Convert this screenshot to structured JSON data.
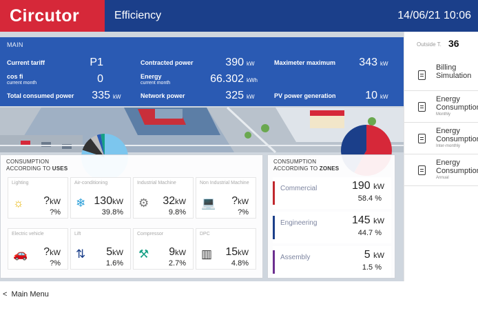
{
  "header": {
    "logo": "Circutor",
    "title": "Efficiency",
    "datetime": "14/06/21 10:06"
  },
  "main": {
    "section": "MAIN",
    "rows": [
      [
        {
          "label": "Current tariff",
          "value": "P1",
          "unit": ""
        },
        {
          "label": "Contracted power",
          "value": "390",
          "unit": "kW"
        },
        {
          "label": "Maximeter maximum",
          "value": "343",
          "unit": "kW"
        }
      ],
      [
        {
          "label": "cos fi",
          "sublabel": "current month",
          "value": "0",
          "unit": ""
        },
        {
          "label": "Energy",
          "sublabel": "current month",
          "value": "66.302",
          "unit": "kWh"
        }
      ],
      [
        {
          "label": "Total consumed power",
          "value": "335",
          "unit": "kW"
        },
        {
          "label": "Network power",
          "value": "325",
          "unit": "kW"
        },
        {
          "label": "PV power generation",
          "value": "10",
          "unit": "kW"
        }
      ]
    ]
  },
  "uses": {
    "title_line1": "CONSUMPTION",
    "title_line2_prefix": "ACCORDING TO ",
    "title_line2_bold": "USES",
    "tiles": [
      {
        "name": "Lighting",
        "icon": "sun-icon",
        "glyph": "☼",
        "color": "#e8b400",
        "kw": "?",
        "kw_unit": "kW",
        "pct": "?",
        "pct_unit": "%"
      },
      {
        "name": "Air-conditioning",
        "icon": "snowflake-icon",
        "glyph": "❄",
        "color": "#2b9fd8",
        "kw": "130",
        "kw_unit": "kW",
        "pct": "39.8",
        "pct_unit": "%"
      },
      {
        "name": "Industrial Machine",
        "icon": "gear-icon",
        "glyph": "⚙",
        "color": "#777777",
        "kw": "32",
        "kw_unit": "kW",
        "pct": "9.8",
        "pct_unit": "%"
      },
      {
        "name": "Non Industrial Machine",
        "icon": "laptop-icon",
        "glyph": "💻",
        "color": "#d62839",
        "kw": "?",
        "kw_unit": "kW",
        "pct": "?",
        "pct_unit": "%"
      },
      {
        "name": "Electric vehicle",
        "icon": "car-icon",
        "glyph": "🚗",
        "color": "#7cb518",
        "kw": "?",
        "kw_unit": "kW",
        "pct": "?",
        "pct_unit": "%"
      },
      {
        "name": "Lift",
        "icon": "elevator-icon",
        "glyph": "⇅",
        "color": "#1b3f8a",
        "kw": "5",
        "kw_unit": "kW",
        "pct": "1.6",
        "pct_unit": "%"
      },
      {
        "name": "Compressor",
        "icon": "compressor-icon",
        "glyph": "⚒",
        "color": "#16a085",
        "kw": "9",
        "kw_unit": "kW",
        "pct": "2.7",
        "pct_unit": "%"
      },
      {
        "name": "DPC",
        "icon": "server-icon",
        "glyph": "▥",
        "color": "#333333",
        "kw": "15",
        "kw_unit": "kW",
        "pct": "4.8",
        "pct_unit": "%"
      }
    ]
  },
  "zones": {
    "title_line1": "CONSUMPTION",
    "title_line2_prefix": "ACCORDING TO ",
    "title_line2_bold": "ZONES",
    "items": [
      {
        "name": "Commercial",
        "color": "#c0272d",
        "kw": "190",
        "kw_unit": "kW",
        "pct": "58.4",
        "pct_unit": "%"
      },
      {
        "name": "Engineering",
        "color": "#1b3f8a",
        "kw": "145",
        "kw_unit": "kW",
        "pct": "44.7",
        "pct_unit": "%"
      },
      {
        "name": "Assembly",
        "color": "#6c2f8f",
        "kw": "5",
        "kw_unit": "kW",
        "pct": "1.5",
        "pct_unit": "%"
      }
    ]
  },
  "pies": {
    "uses": {
      "colors": [
        "#7cc6ee",
        "#333333",
        "#bfbfbf",
        "#2a5ab3",
        "#16a085"
      ],
      "fractions": [
        0.8,
        0.098,
        0.048,
        0.027,
        0.027
      ]
    },
    "zones": {
      "colors": [
        "#d62839",
        "#1b3f8a"
      ],
      "fractions": [
        0.58,
        0.42
      ]
    }
  },
  "right_panel": {
    "outside_label": "Outside T.",
    "outside_value": "36",
    "items": [
      {
        "line1": "Billing",
        "line2": "Simulation",
        "line3": ""
      },
      {
        "line1": "Energy",
        "line2": "Consumption",
        "line3": "Monthly"
      },
      {
        "line1": "Energy",
        "line2": "Consumption",
        "line3": "Inter-monthly"
      },
      {
        "line1": "Energy",
        "line2": "Consumption",
        "line3": "Annual"
      }
    ]
  },
  "footer": {
    "main_menu": "Main Menu"
  }
}
